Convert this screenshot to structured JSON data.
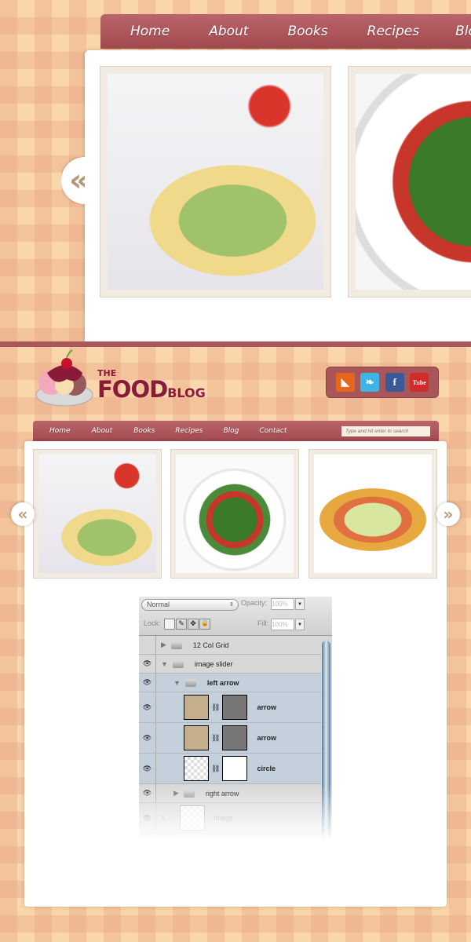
{
  "top": {
    "nav": [
      "Home",
      "About",
      "Books",
      "Recipes",
      "Blog"
    ],
    "arrow": "«"
  },
  "header": {
    "logo_the": "THE",
    "logo_food": "FOOD",
    "logo_blog": "BLOG",
    "social": [
      {
        "icon": "rss-icon",
        "glyph": "◣",
        "color": "#e8661c"
      },
      {
        "icon": "twitter-icon",
        "glyph": "❧",
        "color": "#3bb6e6"
      },
      {
        "icon": "facebook-icon",
        "glyph": "f",
        "color": "#3b5998"
      },
      {
        "icon": "youtube-icon",
        "glyph": "Tube",
        "color": "#d32a2a"
      }
    ]
  },
  "nav": {
    "items": [
      "Home",
      "About",
      "Books",
      "Recipes",
      "Blog",
      "Contact"
    ],
    "search_placeholder": "Type and hit enter to search"
  },
  "slider": {
    "prev": "«",
    "next": "»"
  },
  "layers": {
    "blend": "Normal",
    "opacity_label": "Opacity:",
    "opacity": "100%",
    "lock_label": "Lock:",
    "fill_label": "Fill:",
    "fill": "100%",
    "rows": [
      {
        "name": "12 Col Grid",
        "visible": false
      },
      {
        "name": "image slider",
        "visible": true
      },
      {
        "name": "left arrow",
        "visible": true
      },
      {
        "name": "arrow",
        "visible": true
      },
      {
        "name": "arrow",
        "visible": true
      },
      {
        "name": "circle",
        "visible": true
      },
      {
        "name": "right arrow",
        "visible": true
      },
      {
        "name": "image",
        "visible": true
      }
    ]
  },
  "colors": {
    "brand": "#a8525a",
    "logo": "#8a1a3a"
  }
}
